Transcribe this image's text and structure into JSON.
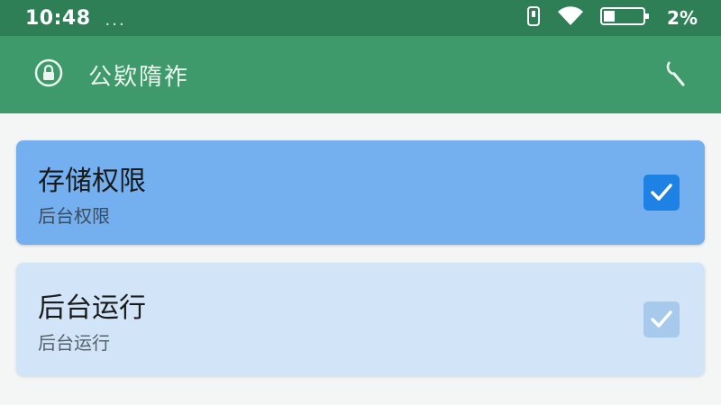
{
  "status_bar": {
    "time": "10:48",
    "dots": "...",
    "battery_percent": "2%"
  },
  "app_bar": {
    "title": "公欵隋祚",
    "lock_icon": "lock-circle-icon",
    "search_icon": "search-icon"
  },
  "permissions": [
    {
      "title": "存储权限",
      "subtitle": "后台权限",
      "checked": true
    },
    {
      "title": "后台运行",
      "subtitle": "后台运行",
      "checked": true
    }
  ],
  "colors": {
    "status_bar": "#2f7f56",
    "app_bar": "#3e9a6b",
    "card_active": "#74aff0",
    "card_inactive": "#d2e5f8",
    "checkbox_active": "#1e82e4"
  }
}
